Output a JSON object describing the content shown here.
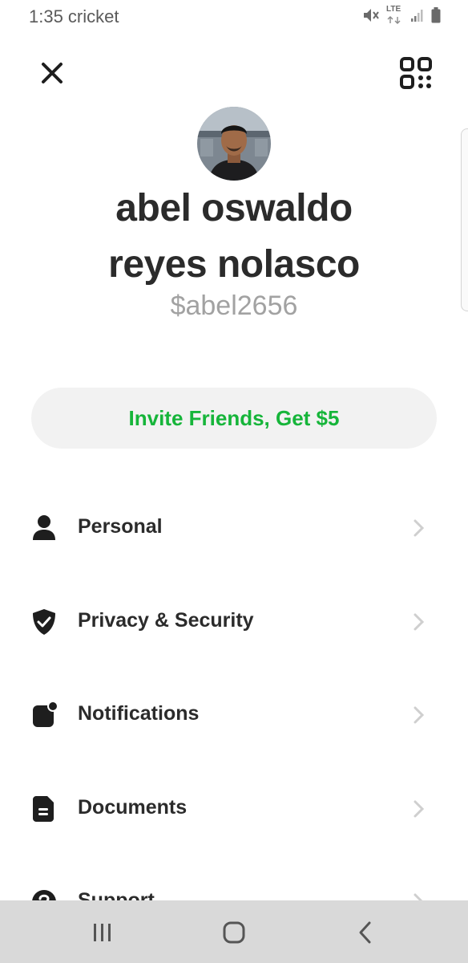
{
  "status_bar": {
    "time_carrier": "1:35 cricket",
    "network": "LTE",
    "icons": [
      "mute-icon",
      "lte-icon",
      "signal-icon",
      "battery-icon"
    ]
  },
  "header": {
    "close_icon": "close-icon",
    "qr_icon": "qr-code-icon"
  },
  "profile": {
    "name_line1": "abel oswaldo",
    "name_line2": "reyes nolasco",
    "cashtag": "$abel2656"
  },
  "invite": {
    "label": "Invite Friends, Get $5",
    "color": "#16b53a"
  },
  "menu": {
    "items": [
      {
        "label": "Personal",
        "icon": "person-icon"
      },
      {
        "label": "Privacy & Security",
        "icon": "shield-check-icon"
      },
      {
        "label": "Notifications",
        "icon": "notification-icon"
      },
      {
        "label": "Documents",
        "icon": "document-icon"
      },
      {
        "label": "Support",
        "icon": "help-icon"
      }
    ]
  },
  "nav_bar": {
    "buttons": [
      "recent-apps-icon",
      "home-icon",
      "back-icon"
    ]
  }
}
